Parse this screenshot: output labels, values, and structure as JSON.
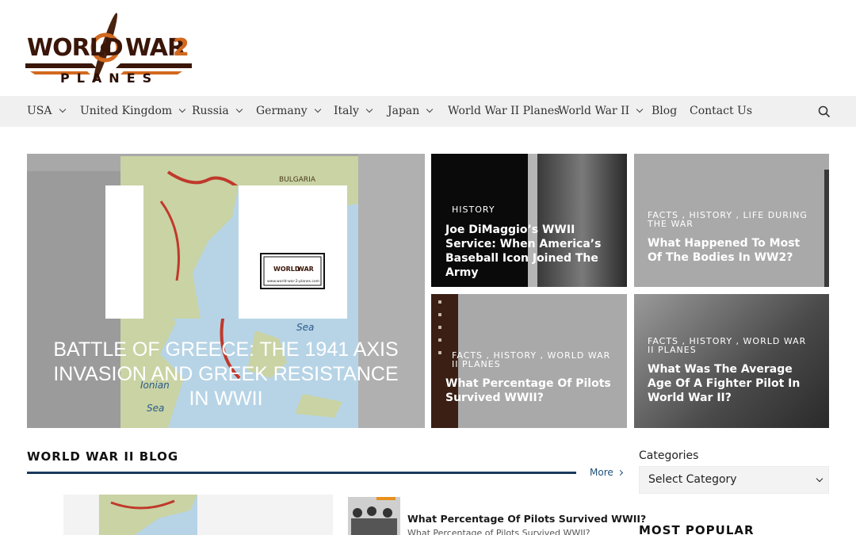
{
  "logo": {
    "line1": "WORLD",
    "line2": "WAR",
    "num": "2",
    "sub": "PLANES"
  },
  "nav": {
    "items": [
      {
        "label": "USA",
        "dropdown": true
      },
      {
        "label": "United Kingdom",
        "dropdown": true
      },
      {
        "label": "Russia",
        "dropdown": true
      },
      {
        "label": "Germany",
        "dropdown": true
      },
      {
        "label": "Italy",
        "dropdown": true
      },
      {
        "label": "Japan",
        "dropdown": true
      },
      {
        "label": "World War II Planes",
        "dropdown": false
      },
      {
        "label": "World War II",
        "dropdown": true
      },
      {
        "label": "Blog",
        "dropdown": false
      },
      {
        "label": "Contact Us",
        "dropdown": false
      }
    ]
  },
  "hero": {
    "title": "BATTLE OF GREECE: THE 1941 AXIS INVASION AND GREEK RESISTANCE IN WWII",
    "map_labels": {
      "bulgaria": "BULGARIA",
      "sea1": "Sea",
      "ionian": "Ionian",
      "sea2": "Sea"
    },
    "badge_url": "www.world-war-2-planes.com"
  },
  "cards": [
    {
      "cats": "HISTORY",
      "title": "Joe DiMaggio’s WWII Service: When America’s Baseball Icon Joined The Army"
    },
    {
      "cats": "FACTS , HISTORY , LIFE DURING THE WAR",
      "title": "What Happened To Most Of The Bodies In WW2?"
    },
    {
      "cats": "FACTS , HISTORY , WORLD WAR II PLANES",
      "title": "What Percentage Of Pilots Survived WWII?"
    },
    {
      "cats": "FACTS , HISTORY , WORLD WAR II PLANES",
      "title": "What Was The Average Age Of A Fighter Pilot In World War II?"
    }
  ],
  "blog": {
    "heading": "WORLD WAR II BLOG",
    "more": "More",
    "post_title": "What Percentage Of Pilots Survived WWII?",
    "post_excerpt": "What Percentage of Pilots Survived WWII?"
  },
  "sidebar": {
    "categories_label": "Categories",
    "select_value": "Select Category",
    "most_popular": "MOST POPULAR"
  },
  "colors": {
    "nav_bg": "#f0f0f0",
    "accent": "#1b3a5c",
    "logo_brown": "#3a1608",
    "logo_orange": "#d2691e"
  }
}
